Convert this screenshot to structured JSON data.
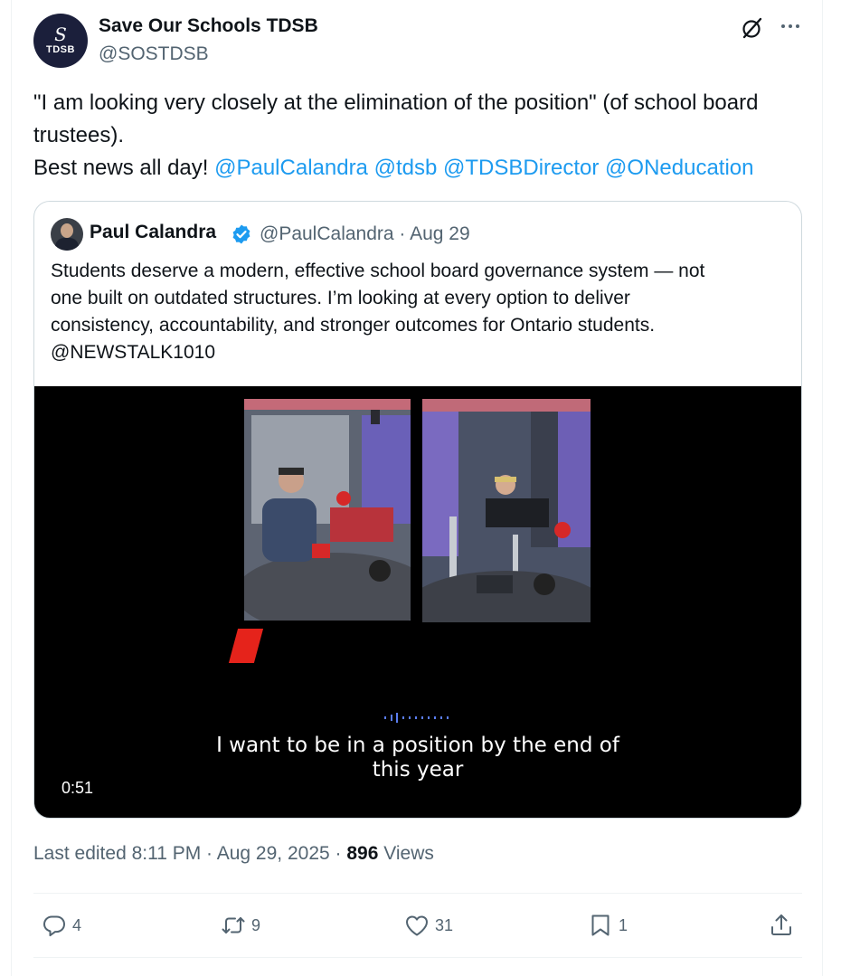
{
  "author": {
    "display_name": "Save Our Schools TDSB",
    "handle": "@SOSTDSB",
    "avatar_text": "TDSB",
    "avatar_mark": "S"
  },
  "tweet": {
    "line1_prefix": "\"I am looking very closely at the elimination of the position\" (of school board trustees).",
    "line2_prefix": "Best news all day!",
    "mentions": [
      "@PaulCalandra",
      "@tdsb",
      "@TDSBDirector",
      "@ONeducation"
    ]
  },
  "quoted": {
    "display_name": "Paul Calandra",
    "handle_date": "@PaulCalandra · Aug 29",
    "text_lines": [
      "Students deserve a modern, effective school board governance system — not",
      "one built on outdated structures. I’m looking at every option to deliver",
      "consistency, accountability, and stronger outcomes for Ontario students.",
      "@NEWSTALK1010"
    ],
    "video": {
      "caption_line1": "I want to be in a position by the end of",
      "caption_line2": "this year",
      "timestamp": "0:51"
    }
  },
  "meta": {
    "edited": "Last edited 8:11 PM · Aug 29, 2025 ·",
    "views_count": "896",
    "views_label": "Views"
  },
  "actions": {
    "replies": "4",
    "reposts": "9",
    "likes": "31",
    "bookmarks": "1"
  },
  "colors": {
    "link": "#1d9bf0",
    "secondary_text": "#536471",
    "verified": "#1d9bf0",
    "accent_red": "#e5231b"
  },
  "icons": [
    "grok-icon",
    "more-icon",
    "verified-icon",
    "reply-icon",
    "repost-icon",
    "like-icon",
    "bookmark-icon",
    "share-icon"
  ]
}
